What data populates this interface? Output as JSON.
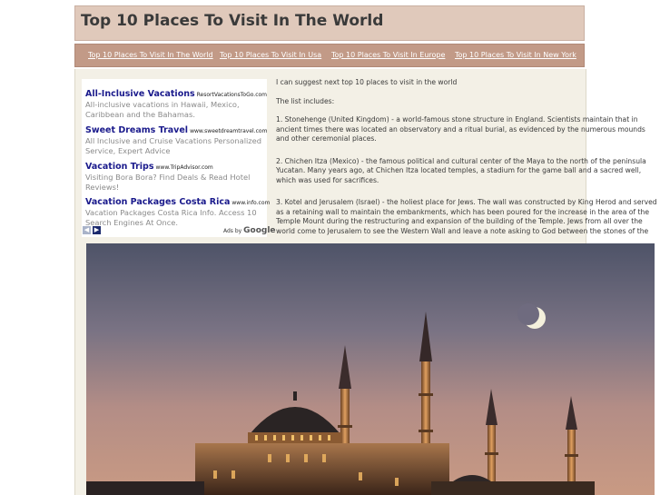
{
  "header": {
    "title": "Top 10 Places To Visit In The World"
  },
  "nav": {
    "links": [
      "Top 10 Places To Visit In The World",
      "Top 10 Places To Visit In Usa",
      "Top 10 Places To Visit In Europe",
      "Top 10 Places To Visit In New York"
    ]
  },
  "ads": {
    "items": [
      {
        "title": "All-Inclusive Vacations",
        "url": "ResortVacationsToGo.com",
        "desc": "All-inclusive vacations in Hawaii, Mexico, Caribbean and the Bahamas."
      },
      {
        "title": "Sweet Dreams Travel",
        "url": "www.sweetdreamtravel.com",
        "desc": "All Inclusive and Cruise Vacations Personalized Service, Expert Advice"
      },
      {
        "title": "Vacation Trips",
        "url": "www.TripAdvisor.com",
        "desc": "Visiting Bora Bora? Find Deals & Read Hotel Reviews!"
      },
      {
        "title": "Vacation Packages Costa Rica",
        "url": "www.info.com",
        "desc": "Vacation Packages Costa Rica Info. Access 10 Search Engines At Once."
      }
    ],
    "prev_icon": "◀",
    "next_icon": "▶",
    "ads_by": "Ads by",
    "google": "Google"
  },
  "article": {
    "intro": "I can suggest next top 10 places to visit in the world",
    "list_intro": "The list includes:",
    "items": [
      "1. Stonehenge (United Kingdom) - a world-famous stone structure in England. Scientists maintain that in ancient times there was located an observatory and a ritual burial, as evidenced by the numerous mounds and other ceremonial places.",
      "2. Chichen Itza (Mexico) - the famous political and cultural center of the Maya to the north of the peninsula Yucatan. Many years ago, at Chichen Itza located temples, a stadium for the game ball and a sacred well, which was used for sacrifices.",
      "3. Kotel and Jerusalem (Israel) - the holiest place for Jews. The wall was constructed by King Herod and served as a retaining wall to maintain the embankments, which has been poured for the increase in the area of the Temple Mount during the restructuring and expansion of the building of the Temple. Jews from all over the world come to Jerusalem to see the Western Wall and leave a note asking to God between the stones of the"
    ]
  },
  "colors": {
    "header_bg": "#e0c9bb",
    "nav_bg": "#c29a87",
    "content_bg": "#f3f0e6",
    "ad_title": "#1a1a8c",
    "ad_arrow_prev": "#a9b3c9",
    "ad_arrow_next": "#1c2a6e"
  }
}
